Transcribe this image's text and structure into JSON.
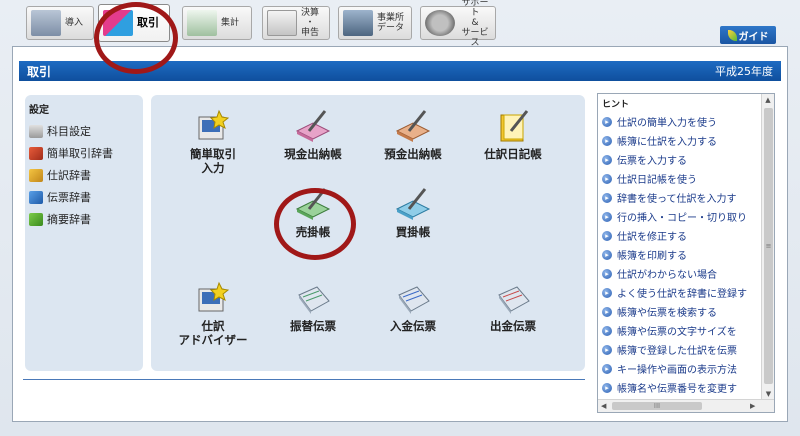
{
  "tabs": [
    {
      "label": "導入",
      "active": false
    },
    {
      "label": "取引",
      "active": true
    },
    {
      "label": "集計",
      "active": false
    },
    {
      "label": "決算\n・\n申告",
      "active": false
    },
    {
      "label": "事業所\nデータ",
      "active": false
    },
    {
      "label": "サポート\n&\nサービス",
      "active": false
    }
  ],
  "guide_button": "ガイド",
  "window": {
    "title": "取引",
    "era": "平成25年度"
  },
  "settings": {
    "title": "設定",
    "items": [
      "科目設定",
      "簡単取引辞書",
      "仕訳辞書",
      "伝票辞書",
      "摘要辞書"
    ]
  },
  "functions": {
    "kantan": "簡単取引\n入力",
    "cash_book": "現金出納帳",
    "deposit_book": "預金出納帳",
    "journal_diary": "仕訳日記帳",
    "sales_ledger": "売掛帳",
    "purchase_ledger": "買掛帳",
    "advisor": "仕訳\nアドバイザー",
    "transfer_slip": "振替伝票",
    "receipt_slip": "入金伝票",
    "payment_slip": "出金伝票"
  },
  "hint": {
    "title": "ヒント",
    "items": [
      "仕訳の簡単入力を使う",
      "帳簿に仕訳を入力する",
      "伝票を入力する",
      "仕訳日記帳を使う",
      "辞書を使って仕訳を入力す",
      "行の挿入・コピー・切り取り",
      "仕訳を修正する",
      "帳簿を印刷する",
      "仕訳がわからない場合",
      "よく使う仕訳を辞書に登録す",
      "帳簿や伝票を検索する",
      "帳簿や伝票の文字サイズを",
      "帳簿で登録した仕訳を伝票",
      "キー操作や画面の表示方法",
      "帳簿名や伝票番号を変更す"
    ]
  },
  "colors": {
    "title_bar": "#1560b7",
    "highlight_circle": "#a01818",
    "panel_bg": "#dce6f1"
  }
}
